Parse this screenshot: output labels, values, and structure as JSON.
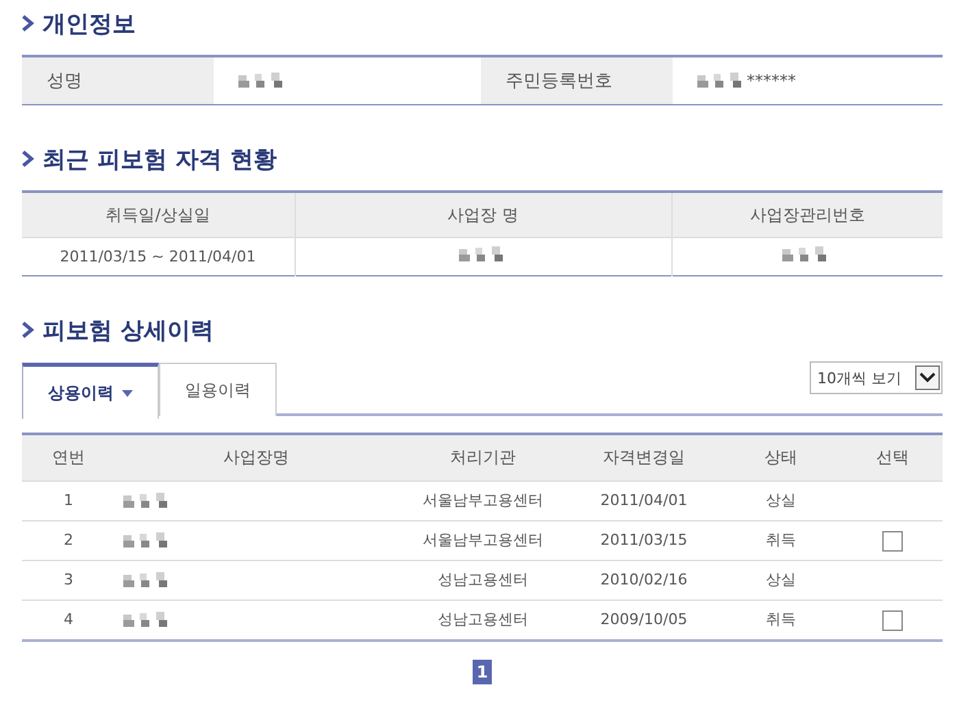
{
  "sections": [
    {
      "title": "개인정보",
      "kind": "info",
      "fields": [
        {
          "label": "성명",
          "value": [
            {
              "kind": "redacted"
            }
          ]
        },
        {
          "label": "주민등록번호",
          "value": [
            {
              "kind": "redacted"
            },
            {
              "kind": "text",
              "text": "******"
            }
          ]
        }
      ]
    },
    {
      "title": "최근 피보험 자격 현황",
      "kind": "table",
      "columns": [
        "취득일/상실일",
        "사업장 명",
        "사업장관리번호"
      ],
      "rows": [
        [
          [
            {
              "kind": "text",
              "text": "2011/03/15 ~ 2011/04/01"
            }
          ],
          [
            {
              "kind": "redacted"
            }
          ],
          [
            {
              "kind": "redacted"
            }
          ]
        ]
      ]
    },
    {
      "title": "피보험 상세이력",
      "kind": "history",
      "tabs": [
        {
          "label": "상용이력",
          "selected": true
        },
        {
          "label": "일용이력",
          "selected": false
        }
      ],
      "page_size": {
        "value": "10개씩 보기"
      },
      "columns": [
        "연번",
        "사업장명",
        "처리기관",
        "자격변경일",
        "상태",
        "선택"
      ],
      "rows": [
        {
          "no": "1",
          "office": "서울남부고용센터",
          "date": "2011/04/01",
          "status": "상실"
        },
        {
          "no": "2",
          "office": "서울남부고용센터",
          "date": "2011/03/15",
          "status": "취득",
          "checked": false
        },
        {
          "no": "3",
          "office": "성남고용센터",
          "date": "2010/02/16",
          "status": "상실"
        },
        {
          "no": "4",
          "office": "성남고용센터",
          "date": "2009/10/05",
          "status": "취득",
          "checked": false
        }
      ],
      "pagination": [
        {
          "label": "1",
          "selected": true
        }
      ]
    }
  ]
}
